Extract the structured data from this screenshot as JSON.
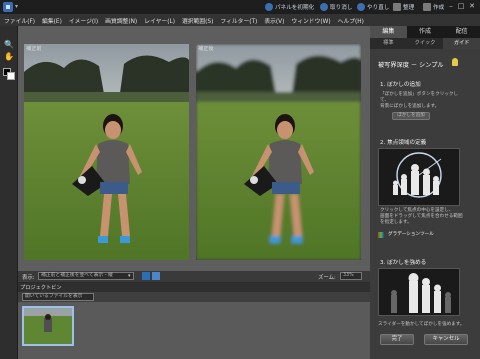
{
  "titlebar": {
    "buttons": [
      {
        "label": "パネルを初期化",
        "icon": "reset-panels-icon"
      },
      {
        "label": "取り消し",
        "icon": "undo-icon"
      },
      {
        "label": "やり直し",
        "icon": "redo-icon"
      },
      {
        "label": "整理",
        "icon": "organize-icon"
      },
      {
        "label": "作成",
        "icon": "create-icon"
      }
    ],
    "window_controls": [
      "–",
      "□",
      "✕"
    ]
  },
  "menu": [
    "ファイル(F)",
    "編集(E)",
    "イメージ(I)",
    "画質調整(N)",
    "レイヤー(L)",
    "選択範囲(S)",
    "フィルター(T)",
    "表示(V)",
    "ウィンドウ(W)",
    "ヘルプ(H)"
  ],
  "panel": {
    "tabs": [
      "編集",
      "作成",
      "配信"
    ],
    "active_tab": "編集",
    "subtabs": [
      "標準",
      "クイック",
      "ガイド"
    ],
    "active_subtab": "ガイド",
    "title": "被写界深度 － シンプル",
    "step1": {
      "title": "1. ぼかしの追加",
      "text": [
        "「ぼかしを追加」ボタンをクリックして、",
        "背景にぼかしを追加します。"
      ],
      "button": "ぼかしを追加"
    },
    "step2": {
      "title": "2. 焦点領域の定義",
      "text": [
        "クリックして焦点の中心を設定し、",
        "画面をドラッグして焦点を合わせる範囲",
        "を指定します。"
      ],
      "link": "グラデーションツール"
    },
    "step3": {
      "title": "3. ぼかしを強める",
      "text": [
        "スライダーを動かしてぼかしを強めます。"
      ]
    },
    "done_button": "完了",
    "cancel_button": "キャンセル"
  },
  "workspace": {
    "before_label": "補正前",
    "after_label": "補正後"
  },
  "view": {
    "label": "表示:",
    "select_value": "補正前と補正後を並べて表示 - 縦",
    "zoom_label": "ズーム:",
    "zoom_value": "33%"
  },
  "bin": {
    "title": "プロジェクトビン",
    "select_value": "開いているファイルを表示"
  },
  "colors": {
    "accent": "#3a6fb7",
    "panel_bg": "#3c3c3c",
    "workspace_bg": "#5e5e5e",
    "highlight": "#e6c84a"
  }
}
